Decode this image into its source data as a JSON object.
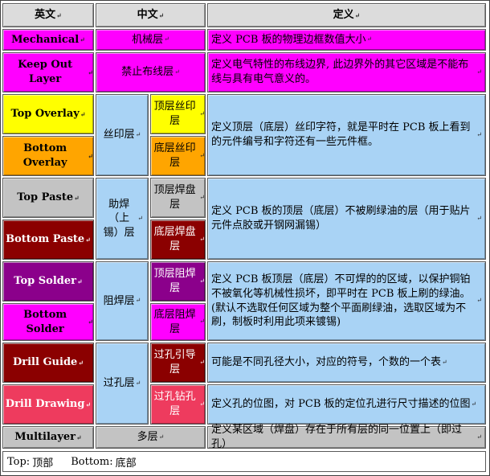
{
  "colors": {
    "header_bg": "#dcdcdc",
    "magenta": "#ff00ff",
    "light_blue": "#a9d3f5",
    "yellow": "#ffff00",
    "orange": "#ffa500",
    "gray": "#c3c3c3",
    "dark_red": "#8b0000",
    "purple": "#8b008b",
    "crimson_pink": "#ee3b5e",
    "paragraph_mark": "↵"
  },
  "header": {
    "col_english": "英文",
    "col_chinese": "中文",
    "col_definition": "定义"
  },
  "rows": {
    "mechanical": {
      "en": "Mechanical",
      "cn": "机械层",
      "def": "定义 PCB 板的物理边框数值大小"
    },
    "keep_out": {
      "en": "Keep Out Layer",
      "cn": "禁止布线层",
      "def": "定义电气特性的布线边界, 此边界外的其它区域是不能布线与具有电气意义的。"
    },
    "overlay": {
      "group_cn": "丝印层",
      "top_en": "Top Overlay",
      "top_cn": "顶层丝印层",
      "bottom_en": "Bottom Overlay",
      "bottom_cn": "底层丝印层",
      "def": "定义顶层（底层）丝印字符，就是平时在 PCB 板上看到的元件编号和字符还有一些元件框。"
    },
    "paste": {
      "group_cn": "助焊（上锡）层",
      "top_en": "Top Paste",
      "top_cn": "顶层焊盘层",
      "bottom_en": "Bottom Paste",
      "bottom_cn": "底层焊盘层",
      "def": "定义 PCB 板的顶层（底层）不被刷绿油的层（用于贴片元件点胶或开钢网漏锡）"
    },
    "solder": {
      "group_cn": "阻焊层",
      "top_en": "Top Solder",
      "top_cn": "顶层阻焊层",
      "bottom_en": "Bottom Solder",
      "bottom_cn": "底层阻焊层",
      "def": "定义 PCB 板顶层（底层）不可焊的的区域，以保护铜铂不被氧化等机械性损坏，即平时在 PCB 板上刷的绿油。(默认不选取任何区域为整个平面刷绿油，选取区域为不刷，制板时利用此项来镀锡)"
    },
    "drill": {
      "group_cn": "过孔层",
      "guide_en": "Drill Guide",
      "guide_cn": "过孔引导层",
      "guide_def": "可能是不同孔径大小，对应的符号，个数的一个表",
      "drawing_en": "Drill Drawing",
      "drawing_cn": "过孔钻孔层",
      "drawing_def": "定义孔的位图，对 PCB 板的定位孔进行尺寸描述的位图"
    },
    "multilayer": {
      "en": "Multilayer",
      "cn": "多层",
      "def": "定义某区域（焊盘）存在于所有层的同一位置上（即过孔）"
    }
  },
  "footer": {
    "top_term": "Top:",
    "top_meaning": "顶部",
    "bottom_term": "Bottom:",
    "bottom_meaning": "底部"
  }
}
